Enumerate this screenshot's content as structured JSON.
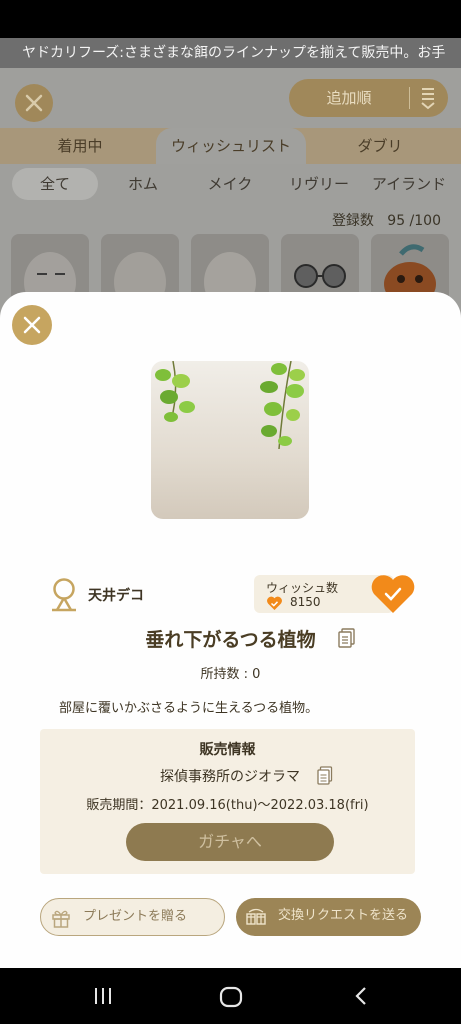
{
  "announcement": "ヤドカリフーズ:さまざまな餌のラインナップを揃えて販売中。お手",
  "header": {
    "sort_label": "追加順"
  },
  "tabs": [
    {
      "label": "着用中",
      "active": false
    },
    {
      "label": "ウィッシュリスト",
      "active": true
    },
    {
      "label": "ダブリ",
      "active": false
    }
  ],
  "subtabs": [
    {
      "label": "全て",
      "active": true
    },
    {
      "label": "ホム",
      "active": false
    },
    {
      "label": "メイク",
      "active": false
    },
    {
      "label": "リヴリー",
      "active": false
    },
    {
      "label": "アイランド",
      "active": false
    }
  ],
  "registered": {
    "label": "登録数",
    "value": "95 /100"
  },
  "item": {
    "category": "天井デコ",
    "wish_label": "ウィッシュ数",
    "wish_count": "8150",
    "name": "垂れ下がるつる植物",
    "owned": "所持数 : 0",
    "description": "部屋に覆いかぶさるように生えるつる植物。"
  },
  "sales": {
    "title": "販売情報",
    "source": "探偵事務所のジオラマ",
    "period": "販売期間：2021.09.16(thu)〜2022.03.18(fri)",
    "gacha_button": "ガチャへ"
  },
  "actions": {
    "present": "プレゼントを贈る",
    "exchange": "交換リクエストを送る"
  },
  "colors": {
    "accent_gold": "#c6a560",
    "heart_orange": "#f28a1a",
    "button_brown": "#9c8556"
  },
  "icons": {
    "close": "close-icon",
    "sort": "sort-icon",
    "category": "ceiling-deco-icon",
    "heart": "heart-check-icon",
    "copy": "copy-icon",
    "gift": "gift-icon",
    "exchange": "exchange-icon"
  }
}
